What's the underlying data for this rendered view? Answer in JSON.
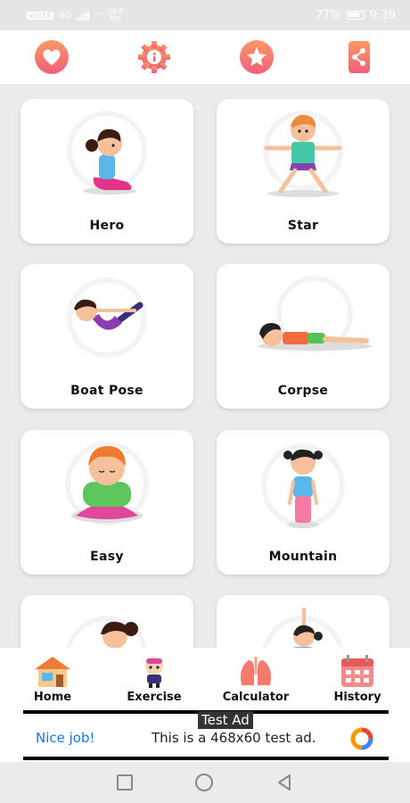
{
  "status_bar": {
    "left_chip": "VoLTE",
    "network": "4G",
    "speed_value": "36.6",
    "speed_unit": "K/s",
    "battery": "77%",
    "time": "9:39"
  },
  "toolbar": {
    "icons": [
      "heart-icon",
      "settings-info-icon",
      "star-icon",
      "share-icon"
    ],
    "accent_gradient": [
      "#fb9a63",
      "#f25f7c"
    ]
  },
  "poses": [
    {
      "label": "Hero"
    },
    {
      "label": "Star"
    },
    {
      "label": "Boat Pose"
    },
    {
      "label": "Corpse"
    },
    {
      "label": "Easy"
    },
    {
      "label": "Mountain"
    },
    {
      "label": ""
    },
    {
      "label": ""
    }
  ],
  "nav": {
    "items": [
      {
        "label": "Home",
        "icon": "home-icon"
      },
      {
        "label": "Exercise",
        "icon": "exercise-icon"
      },
      {
        "label": "Calculator",
        "icon": "lungs-calculator-icon"
      },
      {
        "label": "History",
        "icon": "calendar-icon"
      }
    ]
  },
  "ad": {
    "tag": "Test Ad",
    "headline": "Nice job!",
    "body": "This is a 468x60 test ad."
  }
}
